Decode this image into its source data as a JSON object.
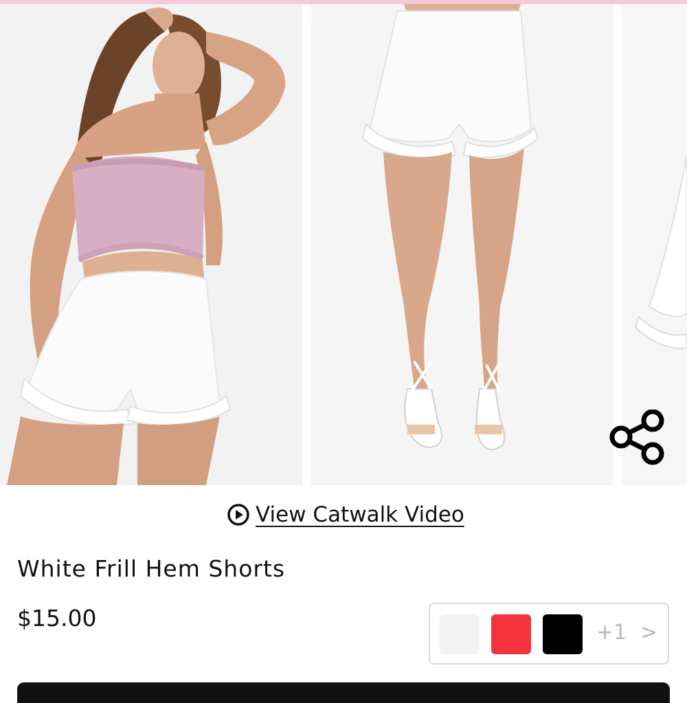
{
  "gallery": {
    "images": [
      {
        "name": "model-front-photo"
      },
      {
        "name": "legs-front-photo"
      },
      {
        "name": "partial-product-photo"
      }
    ],
    "share_icon": "share-icon"
  },
  "video": {
    "label": "View Catwalk Video",
    "icon": "play-circle-icon"
  },
  "product": {
    "title": "White Frill Hem Shorts",
    "price": "$15.00"
  },
  "colors": {
    "swatches": [
      "#f2f2f2",
      "#f4333c",
      "#000000"
    ],
    "more_label": "+1",
    "chevron": ">"
  },
  "theme": {
    "accent": "#f6c8dc"
  }
}
